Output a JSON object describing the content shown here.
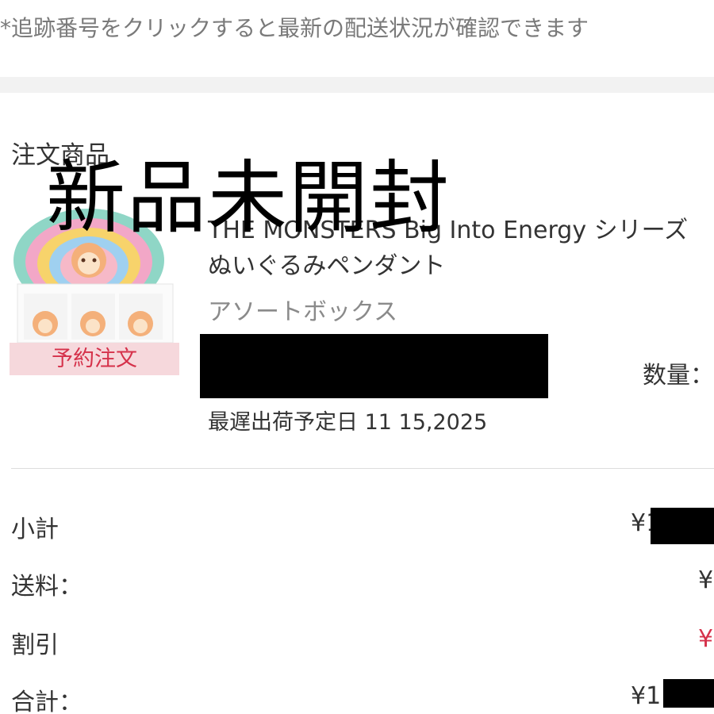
{
  "notice": "*追跡番号をクリックすると最新の配送状況が確認できます",
  "order": {
    "section_title": "注文商品",
    "product": {
      "name_line1": "THE MONSTERS Big Into Energy シリーズ",
      "name_line2": "ぬいぐるみペンダント",
      "variant": "アソートボックス",
      "badge": "予約注文",
      "quantity_label": "数量：",
      "ship_date": "最遅出荷予定日 11 15,2025"
    }
  },
  "summary": {
    "subtotal_label": "小計",
    "subtotal_value": "¥1",
    "shipping_label": "送料：",
    "shipping_value": "¥",
    "discount_label": "割引",
    "discount_value": "¥",
    "total_label": "合計：",
    "total_value": "¥1"
  },
  "overlay_text": "新品未開封",
  "colors": {
    "badge_bg": "#f6d8dc",
    "badge_text": "#d5314a",
    "discount_text": "#d5314a",
    "band_gray": "#f2f2f2"
  }
}
